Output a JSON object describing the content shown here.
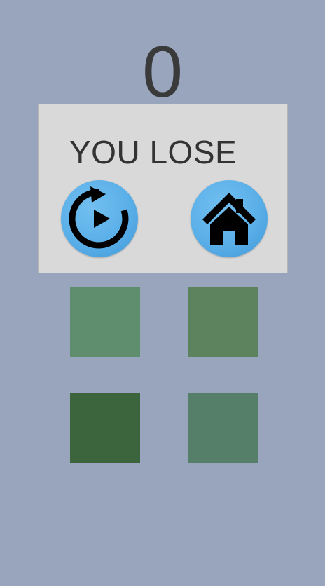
{
  "score": "0",
  "dialog": {
    "title": "YOU LOSE",
    "replay_icon": "replay-icon",
    "home_icon": "home-icon"
  },
  "tiles": [
    {
      "color": "#5e8e6e"
    },
    {
      "color": "#5c835e"
    },
    {
      "color": "#3c653d"
    },
    {
      "color": "#567f6a"
    }
  ]
}
